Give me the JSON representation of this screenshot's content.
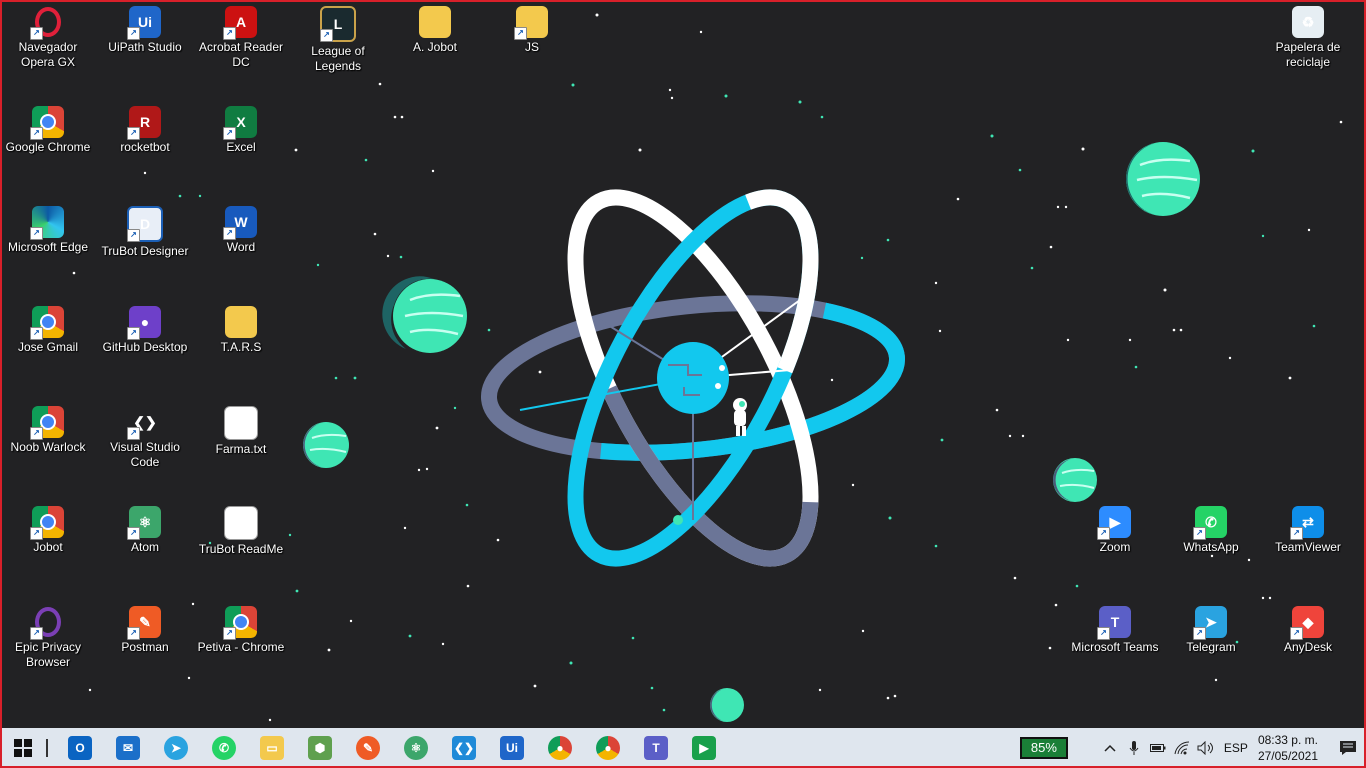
{
  "desktop": {
    "icons": [
      {
        "label": "Navegador Opera GX",
        "icon": "opera-gx-icon"
      },
      {
        "label": "UiPath Studio",
        "icon": "uipath-icon"
      },
      {
        "label": "Acrobat Reader DC",
        "icon": "acrobat-icon"
      },
      {
        "label": "League of Legends",
        "icon": "league-of-legends-icon"
      },
      {
        "label": "A. Jobot",
        "icon": "folder-icon"
      },
      {
        "label": "JS",
        "icon": "folder-chrome-icon"
      },
      {
        "label": "Papelera de reciclaje",
        "icon": "recycle-bin-icon"
      },
      {
        "label": "Google Chrome",
        "icon": "chrome-icon"
      },
      {
        "label": "rocketbot",
        "icon": "rocketbot-icon"
      },
      {
        "label": "Excel",
        "icon": "excel-icon"
      },
      {
        "label": "Microsoft Edge",
        "icon": "edge-icon"
      },
      {
        "label": "TruBot Designer",
        "icon": "trubot-icon"
      },
      {
        "label": "Word",
        "icon": "word-icon"
      },
      {
        "label": "Jose Gmail",
        "icon": "chrome-profile-icon"
      },
      {
        "label": "GitHub Desktop",
        "icon": "github-icon"
      },
      {
        "label": "T.A.R.S",
        "icon": "folder-icon"
      },
      {
        "label": "Noob Warlock",
        "icon": "chrome-profile-icon"
      },
      {
        "label": "Visual Studio Code",
        "icon": "vscode-icon"
      },
      {
        "label": "Farma.txt",
        "icon": "text-file-icon"
      },
      {
        "label": "Jobot",
        "icon": "chrome-profile-icon"
      },
      {
        "label": "Atom",
        "icon": "atom-icon"
      },
      {
        "label": "TruBot ReadMe",
        "icon": "text-file-icon"
      },
      {
        "label": "Epic Privacy Browser",
        "icon": "epic-browser-icon"
      },
      {
        "label": "Postman",
        "icon": "postman-icon"
      },
      {
        "label": "Petiva - Chrome",
        "icon": "chrome-profile-icon"
      },
      {
        "label": "Zoom",
        "icon": "zoom-icon"
      },
      {
        "label": "WhatsApp",
        "icon": "whatsapp-icon"
      },
      {
        "label": "TeamViewer",
        "icon": "teamviewer-icon"
      },
      {
        "label": "Microsoft Teams",
        "icon": "teams-icon"
      },
      {
        "label": "Telegram",
        "icon": "telegram-icon"
      },
      {
        "label": "AnyDesk",
        "icon": "anydesk-icon"
      }
    ]
  },
  "taskbar": {
    "pinned": [
      {
        "name": "outlook",
        "icon": "outlook-icon"
      },
      {
        "name": "mail",
        "icon": "mail-icon"
      },
      {
        "name": "telegram",
        "icon": "telegram-icon"
      },
      {
        "name": "whatsapp",
        "icon": "whatsapp-icon"
      },
      {
        "name": "file-explorer",
        "icon": "folder-icon"
      },
      {
        "name": "nodejs",
        "icon": "nodejs-icon"
      },
      {
        "name": "postman",
        "icon": "postman-icon"
      },
      {
        "name": "atom",
        "icon": "atom-icon"
      },
      {
        "name": "vscode",
        "icon": "vscode-icon"
      },
      {
        "name": "uipath",
        "icon": "uipath-icon"
      },
      {
        "name": "chrome-profile-n",
        "icon": "chrome-profile-icon"
      },
      {
        "name": "chrome-profile",
        "icon": "chrome-profile-icon"
      },
      {
        "name": "teams",
        "icon": "teams-icon"
      },
      {
        "name": "media",
        "icon": "play-icon"
      }
    ],
    "battery_label": "85%",
    "language": "ESP",
    "time": "08:33 p. m.",
    "date": "27/05/2021"
  },
  "colors": {
    "background": "#222224",
    "cyan": "#12c8ee",
    "accent_green": "#3fe6b4",
    "frame_red": "#d8202a"
  }
}
